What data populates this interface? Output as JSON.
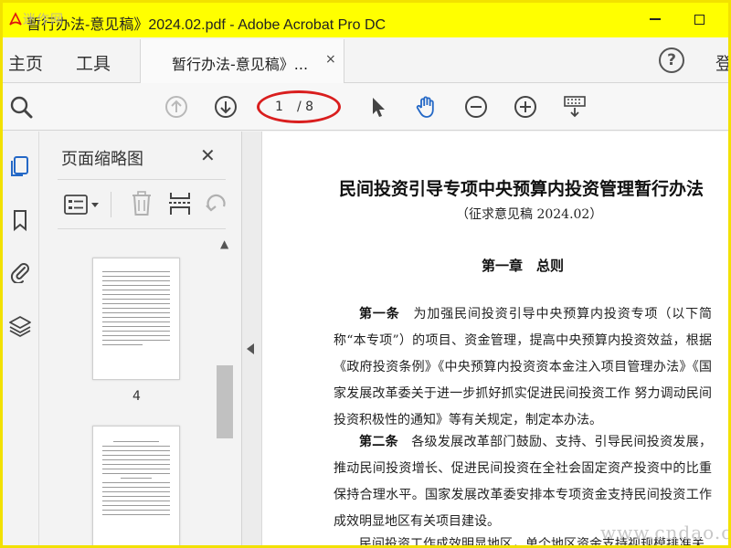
{
  "window": {
    "title": "暂行办法-意见稿》2024.02.pdf - Adobe Acrobat Pro DC",
    "watermark_top_left": "迷作网"
  },
  "tabs": {
    "home": "主页",
    "tools": "工具",
    "document": "暂行办法-意见稿》...",
    "close_glyph": "×",
    "right_edge": "登"
  },
  "toolbar": {
    "page_current": "1",
    "page_total": "/ 8"
  },
  "panel": {
    "title": "页面缩略图",
    "close_glyph": "✕",
    "thumbnail_page_number": "4"
  },
  "document": {
    "title": "民间投资引导专项中央预算内投资管理暂行办法",
    "subtitle": "（征求意见稿 2024.02）",
    "chapter": "第一章　总则",
    "article1_label": "第一条",
    "article1_text": "为加强民间投资引导中央预算内投资专项（以下简称“本专项”）的项目、资金管理，提高中央预算内投资效益，根据《政府投资条例》《中央预算内投资资本金注入项目管理办法》《国家发展改革委关于进一步抓好抓实促进民间投资工作 努力调动民间投资积极性的通知》等有关规定，制定本办法。",
    "article2_label": "第二条",
    "article2_text": "各级发展改革部门鼓励、支持、引导民间投资发展，推动民间投资增长、促进民间投资在全社会固定资产投资中的比重保持合理水平。国家发展改革委安排本专项资金支持民间投资工作成效明显地区有关项目建设。",
    "para3_text": "民间投资工作成效明显地区，单个地区资金支持视规模排准关"
  },
  "watermark_bottom_right": "www.cndao.com",
  "colors": {
    "title_bar": "#ffff00",
    "accent_blue": "#2468c6",
    "annotation_red": "#d91e1e"
  }
}
